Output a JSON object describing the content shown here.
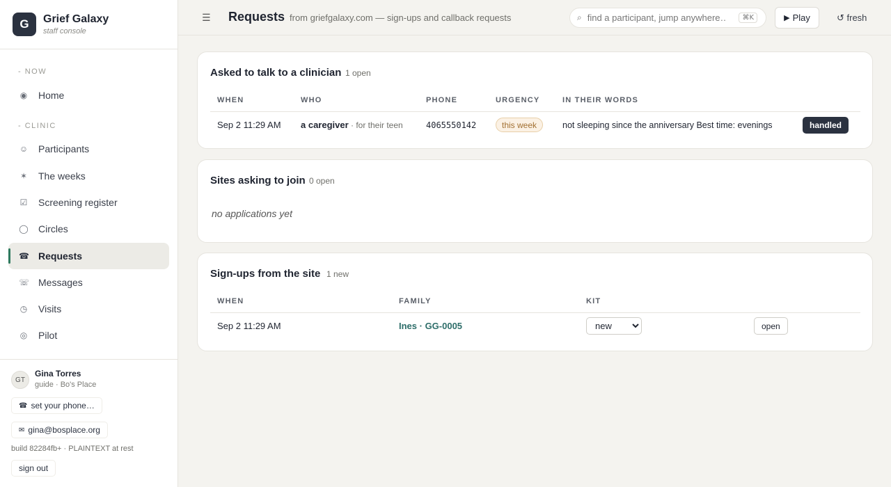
{
  "brand": {
    "logo_letter": "G",
    "name": "Grief Galaxy",
    "subtitle": "staff console"
  },
  "sidebar": {
    "sections": [
      {
        "label": "NOW"
      },
      {
        "label": "CLINIC"
      }
    ],
    "items": [
      {
        "label": "Home",
        "icon": "target-icon"
      },
      {
        "label": "Participants",
        "icon": "smiley-icon"
      },
      {
        "label": "The weeks",
        "icon": "asterisk-icon"
      },
      {
        "label": "Screening register",
        "icon": "checkbox-icon"
      },
      {
        "label": "Circles",
        "icon": "circle-icon"
      },
      {
        "label": "Requests",
        "icon": "phone-icon",
        "active": true
      },
      {
        "label": "Messages",
        "icon": "telephone-icon"
      },
      {
        "label": "Visits",
        "icon": "clock-icon"
      },
      {
        "label": "Pilot",
        "icon": "ring-icon"
      }
    ],
    "footer": {
      "avatar_initials": "GT",
      "user_name": "Gina Torres",
      "user_role": "guide · Bo's Place",
      "phone_label": "set your phone…",
      "email": "gina@bosplace.org",
      "build": "build 82284fb+ · PLAINTEXT at rest",
      "sign_out": "sign out"
    }
  },
  "header": {
    "title": "Requests",
    "subtitle": "from griefgalaxy.com — sign-ups and callback requests",
    "search_placeholder": "find a participant, jump anywhere…",
    "search_shortcut": "⌘K",
    "play_label": "Play",
    "fresh_label": "↺ fresh"
  },
  "clinician": {
    "title": "Asked to talk to a clinician",
    "count": "1 open",
    "columns": [
      "WHEN",
      "WHO",
      "PHONE",
      "URGENCY",
      "IN THEIR WORDS"
    ],
    "rows": [
      {
        "when": "Sep 2 11:29 AM",
        "who": "a caregiver",
        "who_note": " · for their teen",
        "phone": "4065550142",
        "urgency": "this week",
        "words": "not sleeping since the anniversary Best time: evenings",
        "action": "handled"
      }
    ]
  },
  "sites": {
    "title": "Sites asking to join",
    "count": "0 open",
    "empty": "no applications yet"
  },
  "signups": {
    "title": "Sign-ups from the site",
    "count": "1 new",
    "columns": [
      "WHEN",
      "FAMILY",
      "KIT"
    ],
    "rows": [
      {
        "when": "Sep 2 11:29 AM",
        "family": "Ines · GG-0005",
        "kit": "new",
        "action": "open"
      }
    ]
  },
  "colors": {
    "accent": "#2e7a5e",
    "dark": "#2b3240",
    "urgency_bg": "#fbf1e4",
    "urgency_text": "#a27032",
    "link": "#2e6e6a"
  }
}
